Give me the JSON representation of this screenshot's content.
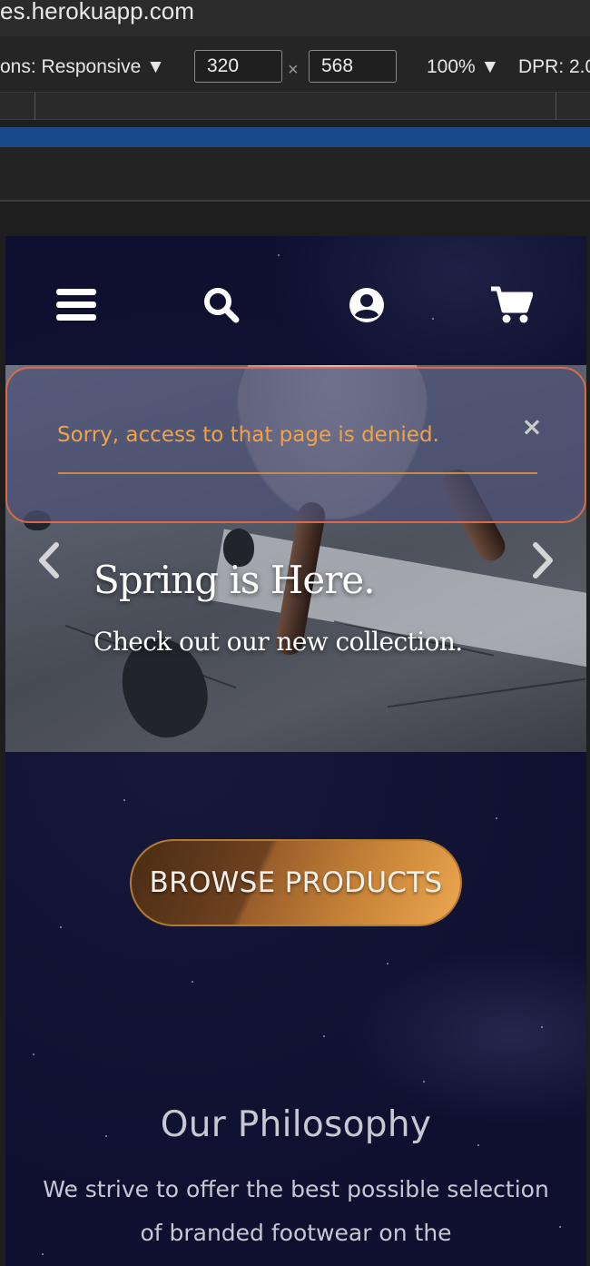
{
  "browser": {
    "url": "es.herokuapp.com",
    "device_label": "ons: Responsive ▼",
    "width_value": "320",
    "height_value": "568",
    "times": "×",
    "zoom": "100% ▼",
    "dpr": "DPR: 2.0"
  },
  "nav": {
    "menu_icon": "hamburger-menu-icon",
    "search_icon": "search-icon",
    "account_icon": "user-circle-icon",
    "cart_icon": "cart-icon"
  },
  "alert": {
    "message": "Sorry, access to that page is denied.",
    "close_label": "×"
  },
  "carousel": {
    "title": "Spring is Here.",
    "subtitle": "Check out our new collection.",
    "prev_icon": "chevron-left-icon",
    "next_icon": "chevron-right-icon"
  },
  "cta": {
    "label": "BROWSE PRODUCTS"
  },
  "philosophy": {
    "title": "Our Philosophy",
    "body": "We strive to offer the best possible selection of branded footwear on the"
  },
  "colors": {
    "alert_text": "#f0a24a",
    "alert_border": "#d86a4a",
    "page_bg": "#0f1030",
    "cta_accent": "#eba74f"
  }
}
